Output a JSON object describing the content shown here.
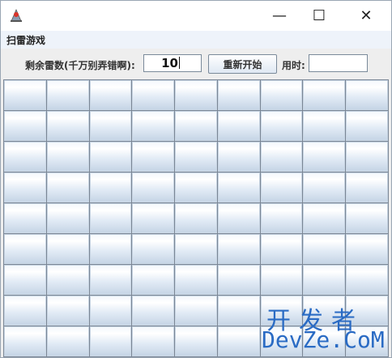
{
  "window": {
    "minimize_symbol": "—",
    "maximize_symbol": "☐",
    "close_symbol": "✕"
  },
  "menubar": {
    "items": [
      {
        "label": "扫雷游戏"
      }
    ]
  },
  "toolbar": {
    "mines_label": "剩余雷数(千万别弄错啊):",
    "mines_value": "10",
    "restart_label": "重新开始",
    "time_label": "用时:",
    "time_value": ""
  },
  "board": {
    "rows": 9,
    "cols": 9
  },
  "watermark": {
    "line1": "开发者",
    "line2": "DevZe.CoM"
  },
  "colors": {
    "accent": "#2a6bc4",
    "cell_top": "#ffffff",
    "cell_bottom": "#c6d5e6",
    "grid_line": "#7b8796"
  },
  "icons": {
    "app": "java-duke-icon"
  }
}
